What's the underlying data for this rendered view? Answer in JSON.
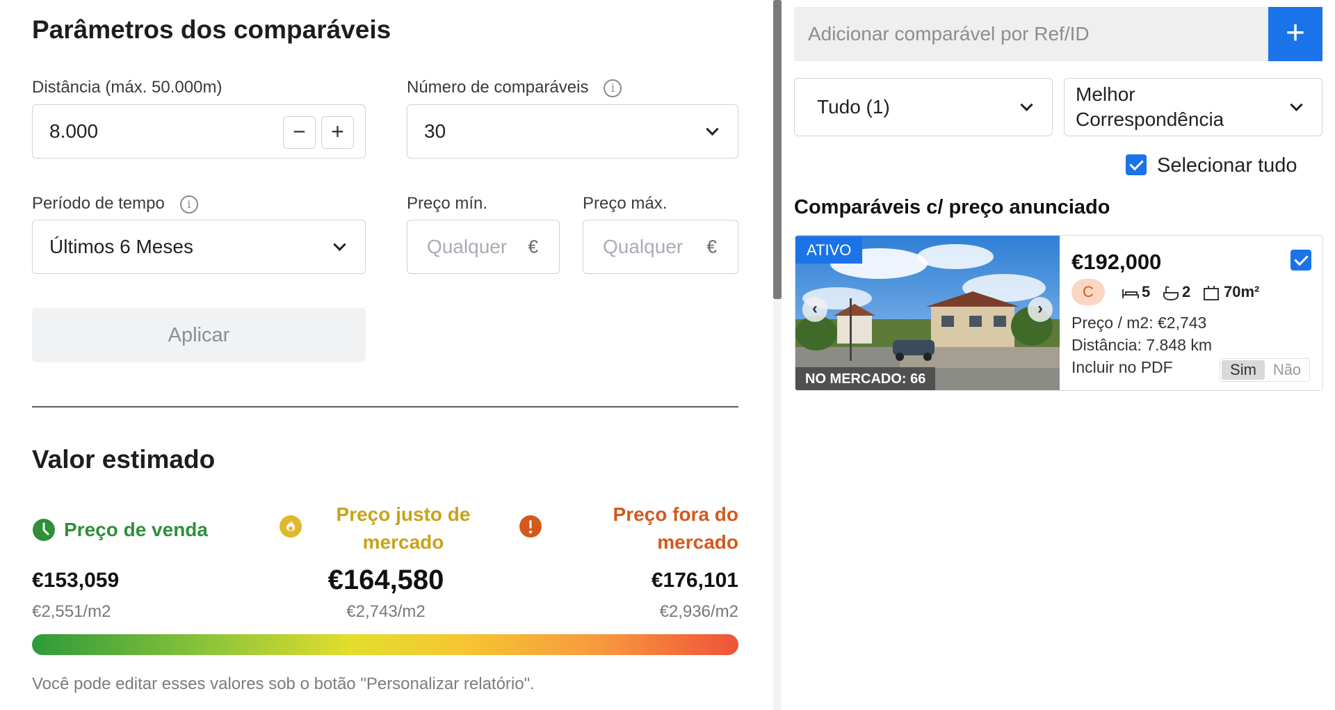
{
  "params": {
    "title": "Parâmetros dos comparáveis",
    "distance": {
      "label": "Distância (máx. 50.000m)",
      "value": "8.000",
      "minus": "−",
      "plus": "+"
    },
    "num_comparables": {
      "label": "Número de comparáveis",
      "value": "30"
    },
    "period": {
      "label": "Período de tempo",
      "value": "Últimos 6 Meses"
    },
    "price_min": {
      "label": "Preço mín.",
      "placeholder": "Qualquer",
      "currency": "€"
    },
    "price_max": {
      "label": "Preço máx.",
      "placeholder": "Qualquer",
      "currency": "€"
    },
    "apply_label": "Aplicar"
  },
  "estimate": {
    "title": "Valor estimado",
    "low": {
      "label": "Preço de venda",
      "value": "€153,059",
      "per_m2": "€2,551/m2",
      "color": "#2f8f3b"
    },
    "fair": {
      "label_line1": "Preço justo de",
      "label_line2": "mercado",
      "value": "€164,580",
      "per_m2": "€2,743/m2",
      "color": "#c9a21a"
    },
    "high": {
      "label_line1": "Preço fora do",
      "label_line2": "mercado",
      "value": "€176,101",
      "per_m2": "€2,936/m2",
      "color": "#d4591c"
    },
    "note": "Você pode editar esses valores sob o botão \"Personalizar relatório\"."
  },
  "right": {
    "add_placeholder": "Adicionar comparável por Ref/ID",
    "add_button": "+",
    "filter_value": "Tudo (1)",
    "sort_line1": "Melhor",
    "sort_line2": "Correspondência",
    "select_all": "Selecionar tudo",
    "section_title": "Comparáveis c/ preço anunciado",
    "accent": "#1a73e8"
  },
  "card": {
    "status": "ATIVO",
    "on_market": "NO MERCADO: 66",
    "price": "€192,000",
    "energy_class": "C",
    "beds": "5",
    "baths": "2",
    "area": "70m²",
    "price_m2": "Preço / m2: €2,743",
    "distance": "Distância: 7.848 km",
    "include_pdf": "Incluir no PDF",
    "yes": "Sim",
    "no": "Não",
    "prev_icon": "‹",
    "next_icon": "›"
  }
}
